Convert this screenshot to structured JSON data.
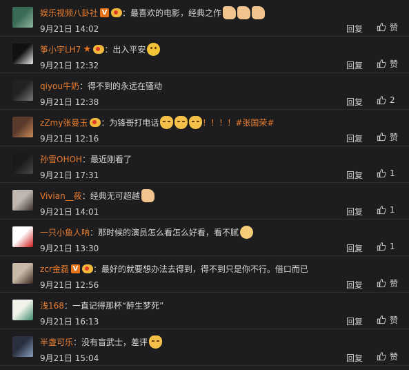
{
  "comments": [
    {
      "user": "娱乐视频八卦社",
      "badge": "v",
      "vip": true,
      "text": "最喜欢的电影，经典之作",
      "emojis": [
        "thumb",
        "thumb",
        "thumb"
      ],
      "hashtag": "",
      "time": "9月21日 14:02",
      "reply": "回复",
      "like": "赞",
      "avatar_colors": [
        "#3a6b56",
        "#8fb6a0"
      ]
    },
    {
      "user": "筝小宇LH7",
      "badge": "star",
      "vip": true,
      "text": "出入平安",
      "emojis": [
        "smile"
      ],
      "hashtag": "",
      "time": "9月21日 12:32",
      "reply": "回复",
      "like": "赞",
      "avatar_colors": [
        "#111111",
        "#eeeeee"
      ]
    },
    {
      "user": "qiyou牛奶",
      "badge": "",
      "vip": false,
      "text": "得不到的永远在骚动",
      "emojis": [],
      "hashtag": "",
      "time": "9月21日 12:38",
      "reply": "回复",
      "like": "2",
      "avatar_colors": [
        "#222222",
        "#777777"
      ]
    },
    {
      "user": "zZmy张曼玉",
      "badge": "",
      "vip": true,
      "text": "为锋哥打电话",
      "emojis": [
        "cat",
        "cat",
        "cat"
      ],
      "hashtag": "！！！！#张国荣#",
      "time": "9月21日 12:16",
      "reply": "回复",
      "like": "赞",
      "avatar_colors": [
        "#5a3a2a",
        "#c98b5a"
      ]
    },
    {
      "user": "孙雪OHOH",
      "badge": "",
      "vip": false,
      "text": "最近刚看了",
      "emojis": [],
      "hashtag": "",
      "time": "9月21日 17:31",
      "reply": "回复",
      "like": "1",
      "avatar_colors": [
        "#1a1a1a",
        "#4a4a4a"
      ]
    },
    {
      "user": "Vivian__莜",
      "badge": "",
      "vip": false,
      "text": "经典无可超越",
      "emojis": [
        "thumb"
      ],
      "hashtag": "",
      "time": "9月21日 14:01",
      "reply": "回复",
      "like": "1",
      "avatar_colors": [
        "#bfb7b0",
        "#3b2f2a"
      ]
    },
    {
      "user": "一只小鱼人呐",
      "badge": "",
      "vip": false,
      "text": "那时候的演员怎么看怎么好看，看不腻",
      "emojis": [
        "sweat"
      ],
      "hashtag": "",
      "time": "9月21日 13:30",
      "reply": "回复",
      "like": "1",
      "avatar_colors": [
        "#ffffff",
        "#cc1a1a"
      ]
    },
    {
      "user": "zcr金磊",
      "badge": "v",
      "vip": true,
      "text": "最好的就要想办法去得到，得不到只是你不行。借口而已",
      "emojis": [],
      "hashtag": "",
      "time": "9月21日 12:56",
      "reply": "回复",
      "like": "赞",
      "avatar_colors": [
        "#c9b9a8",
        "#3a2a20"
      ]
    },
    {
      "user": "浅168",
      "badge": "",
      "vip": false,
      "text": "一直记得那杯“醉生梦死”",
      "emojis": [],
      "hashtag": "",
      "time": "9月21日 16:13",
      "reply": "回复",
      "like": "赞",
      "avatar_colors": [
        "#f2f2ea",
        "#3a8a6a"
      ]
    },
    {
      "user": "半盏可乐",
      "badge": "",
      "vip": false,
      "text": "没有盲武士，差评",
      "emojis": [
        "cat"
      ],
      "hashtag": "",
      "time": "9月21日 15:04",
      "reply": "回复",
      "like": "赞",
      "avatar_colors": [
        "#2a3040",
        "#8aa0c0"
      ]
    }
  ],
  "icons": {
    "like": "thumbs-up-icon",
    "vip": "vip-member-icon",
    "verified": "verified-v-icon",
    "star": "star-icon"
  },
  "colors": {
    "background": "#1d1d1f",
    "username": "#ea7d2e",
    "text": "#d7d7d7",
    "separator": "#2e2e30"
  }
}
